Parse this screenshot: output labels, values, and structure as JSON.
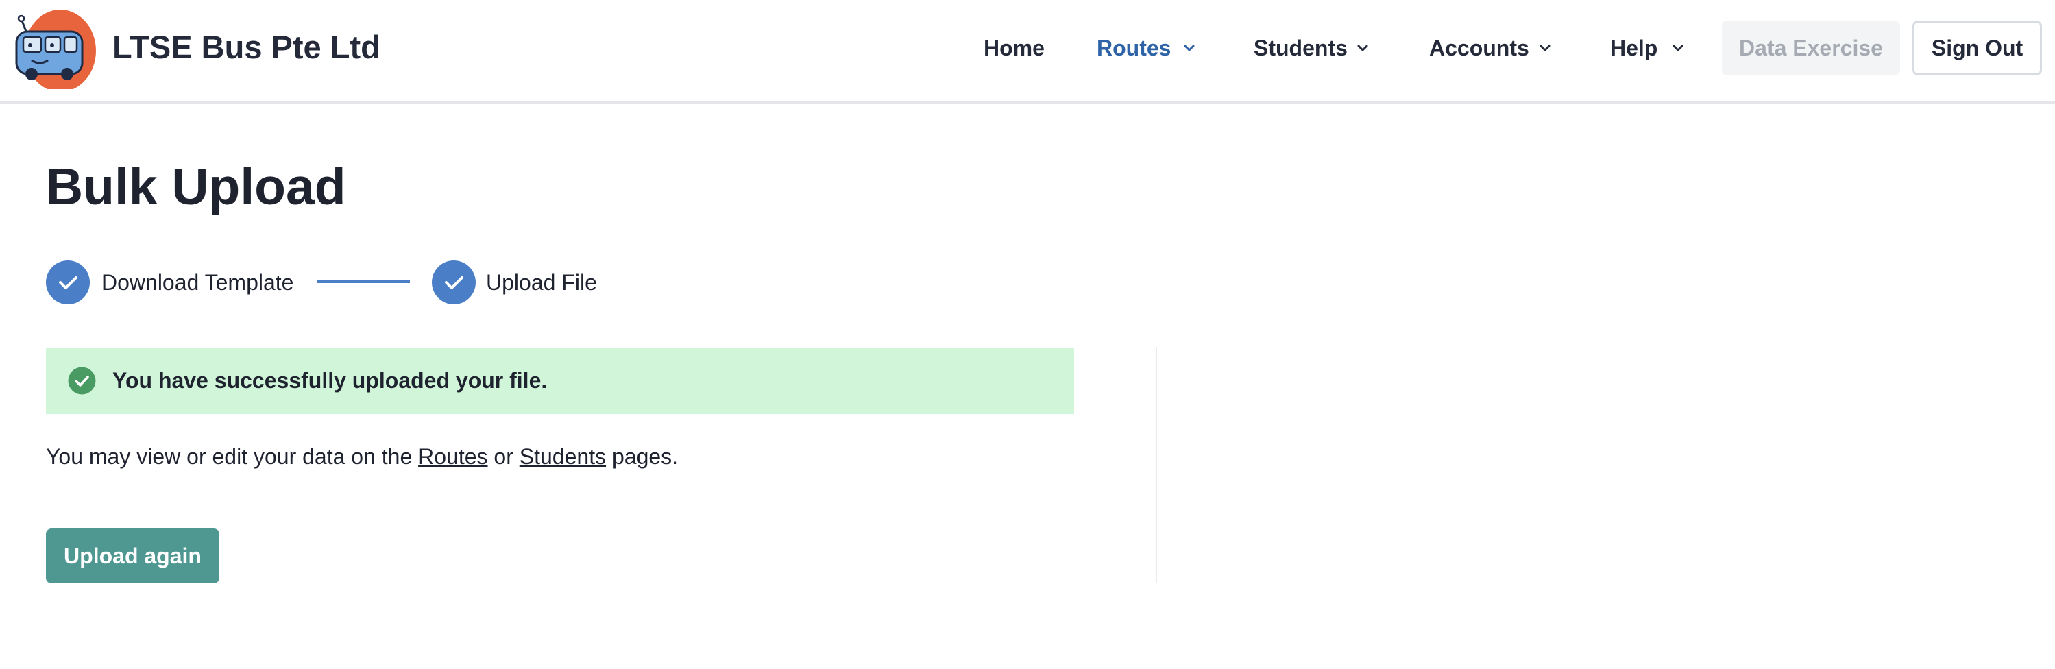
{
  "header": {
    "brand": "LTSE Bus Pte Ltd",
    "logo_icon": "bus-mascot-logo",
    "nav": {
      "home": "Home",
      "routes": "Routes",
      "students": "Students",
      "accounts": "Accounts",
      "help": "Help"
    },
    "active_nav": "Routes",
    "data_exercise_label": "Data Exercise",
    "sign_out_label": "Sign Out"
  },
  "main": {
    "title": "Bulk Upload",
    "steps": [
      {
        "label": "Download Template",
        "status": "complete"
      },
      {
        "label": "Upload File",
        "status": "complete"
      }
    ],
    "alert": {
      "text": "You have successfully uploaded your file.",
      "icon": "check-circle-icon"
    },
    "info": {
      "prefix": "You may view or edit your data on the ",
      "routes_link": "Routes",
      "middle": " or ",
      "students_link": "Students",
      "suffix": " pages."
    },
    "upload_again_label": "Upload again"
  },
  "colors": {
    "accent_blue": "#4a7ec7",
    "active_nav": "#2f63a8",
    "success_bg": "#d1f5d9",
    "success_icon": "#4a9a63",
    "primary_button": "#4f9891",
    "logo_orange": "#e8643c"
  }
}
